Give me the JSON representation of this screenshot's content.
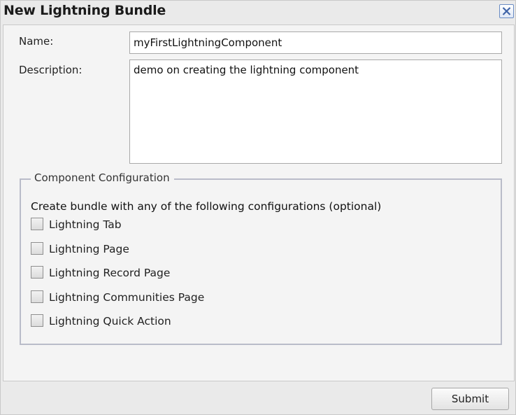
{
  "dialog": {
    "title": "New Lightning Bundle",
    "close_icon": "close-icon"
  },
  "form": {
    "name_label": "Name:",
    "name_value": "myFirstLightningComponent",
    "description_label": "Description:",
    "description_value": "demo on creating the lightning component"
  },
  "config": {
    "legend": "Component Configuration",
    "hint": "Create bundle with any of the following configurations (optional)",
    "options": [
      {
        "label": "Lightning Tab",
        "checked": false
      },
      {
        "label": "Lightning Page",
        "checked": false
      },
      {
        "label": "Lightning Record Page",
        "checked": false
      },
      {
        "label": "Lightning Communities Page",
        "checked": false
      },
      {
        "label": "Lightning Quick Action",
        "checked": false
      }
    ]
  },
  "footer": {
    "submit_label": "Submit"
  },
  "colors": {
    "close_border": "#6a8cc4",
    "close_x": "#3f64a8",
    "fieldset_border": "#b9bcc9"
  }
}
